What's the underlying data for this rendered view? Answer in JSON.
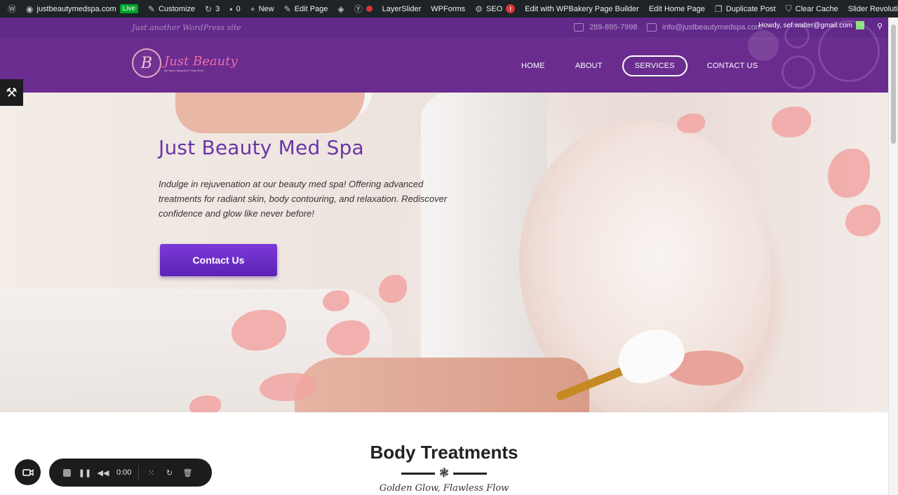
{
  "admin_bar": {
    "site_name": "justbeautymedspa.com",
    "live_badge": "Live",
    "customize": "Customize",
    "updates_count": "3",
    "comments_count": "0",
    "new": "New",
    "edit_page": "Edit Page",
    "layerslider": "LayerSlider",
    "wpforms": "WPForms",
    "seo": "SEO",
    "seo_alert": "!",
    "wpbakery": "Edit with WPBakery Page Builder",
    "edit_home": "Edit Home Page",
    "duplicate": "Duplicate Post",
    "clear_cache": "Clear Cache",
    "slider_revolution": "Slider Revolution"
  },
  "topbar": {
    "tagline": "Just another WordPress site",
    "phone": "289-895-7998",
    "email": "info@justbeautymedspa.com",
    "howdy": "Howdy, sef.walter@gmail.com"
  },
  "logo": {
    "mark": "B",
    "brand": "Just Beauty",
    "sub": "Be More Beautiful Than Ever"
  },
  "nav": {
    "items": [
      {
        "label": "HOME",
        "active": false
      },
      {
        "label": "ABOUT",
        "active": false
      },
      {
        "label": "SERVICES",
        "active": true
      },
      {
        "label": "CONTACT US",
        "active": false
      }
    ]
  },
  "hero": {
    "title": "Just Beauty Med Spa",
    "text": "Indulge in rejuvenation at our beauty med spa! Offering advanced treatments for radiant skin, body contouring, and relaxation. Rediscover confidence and glow like never before!",
    "cta": "Contact Us"
  },
  "section": {
    "title": "Body Treatments",
    "subtitle": "Golden Glow, Flawless Flow"
  },
  "recorder": {
    "time": "0:00"
  },
  "colors": {
    "header_purple": "#6a2c8e",
    "title_purple": "#6a36a6",
    "cta_purple": "#6a2cc6",
    "admin_bar": "#1d2327"
  }
}
